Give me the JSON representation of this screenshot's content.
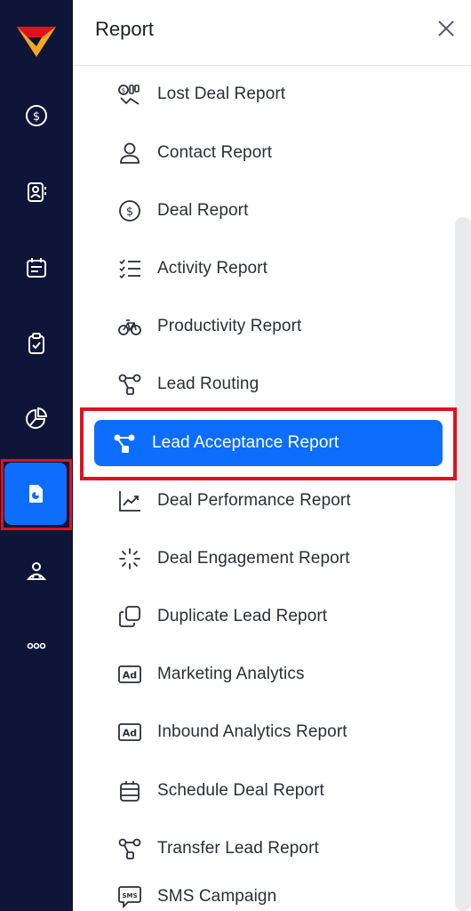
{
  "rail": {
    "icons": [
      "dollar-circle-icon",
      "contact-card-icon",
      "calendar-note-icon",
      "clipboard-check-icon",
      "pie-chart-icon",
      "report-document-icon",
      "user-group-icon",
      "more-dots-icon"
    ]
  },
  "panel": {
    "title": "Report",
    "close_icon": "close-icon"
  },
  "colors": {
    "rail_bg": "#0e1538",
    "accent": "#0d6efd",
    "highlight": "#e0111f"
  },
  "menu": [
    {
      "label": "Lost Deal Report",
      "icon": "lost-deal-icon"
    },
    {
      "label": "Contact Report",
      "icon": "person-icon"
    },
    {
      "label": "Deal Report",
      "icon": "dollar-circle-icon"
    },
    {
      "label": "Activity Report",
      "icon": "checklist-icon"
    },
    {
      "label": "Productivity Report",
      "icon": "bicycle-icon"
    },
    {
      "label": "Lead Routing",
      "icon": "routing-icon"
    },
    {
      "label": "Lead Acceptance Report",
      "icon": "routing-icon",
      "active": true
    },
    {
      "label": "Deal Performance Report",
      "icon": "trend-chart-icon"
    },
    {
      "label": "Deal Engagement Report",
      "icon": "loading-spinner-icon"
    },
    {
      "label": "Duplicate Lead Report",
      "icon": "duplicate-icon"
    },
    {
      "label": "Marketing Analytics",
      "icon": "ad-icon"
    },
    {
      "label": "Inbound Analytics Report",
      "icon": "ad-icon"
    },
    {
      "label": "Schedule Deal Report",
      "icon": "calendar-icon"
    },
    {
      "label": "Transfer Lead Report",
      "icon": "routing-icon"
    },
    {
      "label": "SMS Campaign",
      "icon": "sms-icon"
    }
  ]
}
